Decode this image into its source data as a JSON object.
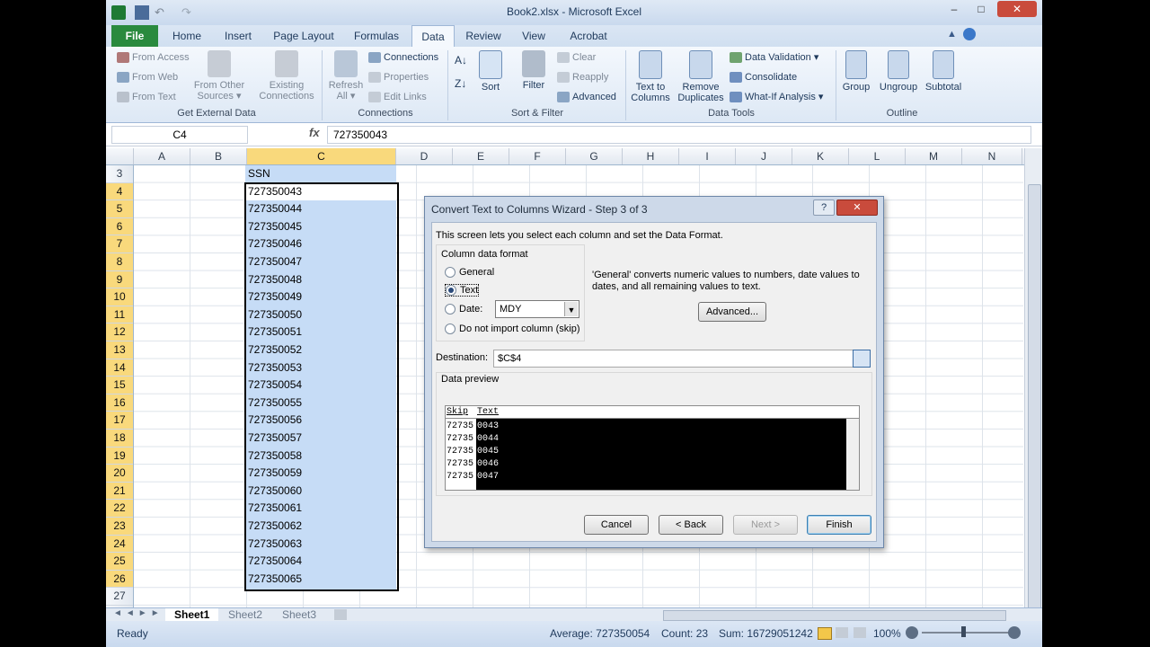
{
  "window": {
    "title": "Book2.xlsx - Microsoft Excel",
    "min": "–",
    "max": "□",
    "close": "✕"
  },
  "tabs": [
    "File",
    "Home",
    "Insert",
    "Page Layout",
    "Formulas",
    "Data",
    "Review",
    "View",
    "Acrobat"
  ],
  "ribbon": {
    "get_external": {
      "from_access": "From Access",
      "from_web": "From Web",
      "from_text": "From Text",
      "from_other": "From Other",
      "sources": "Sources ▾",
      "existing": "Existing",
      "connections_lbl": "Connections",
      "label": "Get External Data"
    },
    "connections": {
      "refresh": "Refresh",
      "all": "All ▾",
      "conn": "Connections",
      "props": "Properties",
      "edit": "Edit Links",
      "label": "Connections"
    },
    "sort": {
      "sort": "Sort",
      "filter": "Filter",
      "clear": "Clear",
      "reapply": "Reapply",
      "advanced": "Advanced",
      "label": "Sort & Filter"
    },
    "tools": {
      "t2c_1": "Text to",
      "t2c_2": "Columns",
      "remove_1": "Remove",
      "remove_2": "Duplicates",
      "validation": "Data Validation ▾",
      "consolidate": "Consolidate",
      "whatif": "What-If Analysis ▾",
      "label": "Data Tools"
    },
    "outline": {
      "group": "Group",
      "ungroup": "Ungroup",
      "subtotal": "Subtotal",
      "label": "Outline"
    }
  },
  "formula_bar": {
    "name_box": "C4",
    "fx": "fx",
    "value": "727350043"
  },
  "columns": [
    "A",
    "B",
    "C",
    "D",
    "E",
    "F",
    "G",
    "H",
    "I",
    "J",
    "K",
    "L",
    "M",
    "N"
  ],
  "rows": [
    "3",
    "4",
    "5",
    "6",
    "7",
    "8",
    "9",
    "10",
    "11",
    "12",
    "13",
    "14",
    "15",
    "16",
    "17",
    "18",
    "19",
    "20",
    "21",
    "22",
    "23",
    "24",
    "25",
    "26",
    "27"
  ],
  "cells_c": [
    "SSN",
    "727350043",
    "727350044",
    "727350045",
    "727350046",
    "727350047",
    "727350048",
    "727350049",
    "727350050",
    "727350051",
    "727350052",
    "727350053",
    "727350054",
    "727350055",
    "727350056",
    "727350057",
    "727350058",
    "727350059",
    "727350060",
    "727350061",
    "727350062",
    "727350063",
    "727350064",
    "727350065"
  ],
  "sheets": [
    "Sheet1",
    "Sheet2",
    "Sheet3"
  ],
  "status": {
    "ready": "Ready",
    "average": "Average: 727350054",
    "count": "Count: 23",
    "sum": "Sum: 16729051242",
    "zoom": "100%"
  },
  "dialog": {
    "title": "Convert Text to Columns Wizard - Step 3 of 3",
    "intro": "This screen lets you select each column and set the Data Format.",
    "format_label": "Column data format",
    "opt_general": "General",
    "opt_text": "Text",
    "opt_date": "Date:",
    "date_value": "MDY",
    "opt_skip": "Do not import column (skip)",
    "desc": "'General' converts numeric values to numbers, date values to dates, and all remaining values to text.",
    "advanced": "Advanced...",
    "dest_label": "Destination:",
    "dest_value": "$C$4",
    "preview_label": "Data preview",
    "preview_headers": [
      "Skip",
      "Text"
    ],
    "preview_left": [
      "72735",
      "72735",
      "72735",
      "72735",
      "72735"
    ],
    "preview_right": [
      "0043",
      "0044",
      "0045",
      "0046",
      "0047"
    ],
    "btn_cancel": "Cancel",
    "btn_back": "< Back",
    "btn_next": "Next >",
    "btn_finish": "Finish"
  }
}
